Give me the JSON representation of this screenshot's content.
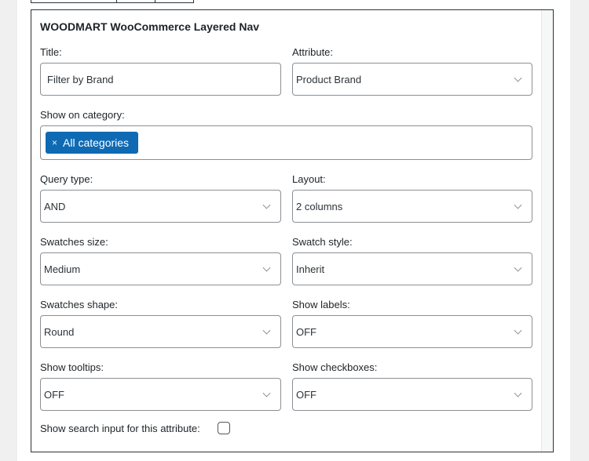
{
  "widget": {
    "title": "WOODMART WooCommerce Layered Nav"
  },
  "fields": {
    "title": {
      "label": "Title:",
      "value": "Filter by Brand"
    },
    "attribute": {
      "label": "Attribute:",
      "value": "Product Brand"
    },
    "show_on_category": {
      "label": "Show on category:",
      "chip_label": "All categories",
      "chip_remove": "×"
    },
    "query_type": {
      "label": "Query type:",
      "value": "AND"
    },
    "layout": {
      "label": "Layout:",
      "value": "2 columns"
    },
    "swatches_size": {
      "label": "Swatches size:",
      "value": "Medium"
    },
    "swatch_style": {
      "label": "Swatch style:",
      "value": "Inherit"
    },
    "swatches_shape": {
      "label": "Swatches shape:",
      "value": "Round"
    },
    "show_labels": {
      "label": "Show labels:",
      "value": "OFF"
    },
    "show_tooltips": {
      "label": "Show tooltips:",
      "value": "OFF"
    },
    "show_checkboxes": {
      "label": "Show checkboxes:",
      "value": "OFF"
    },
    "show_search_input": {
      "label": "Show search input for this attribute:",
      "checked": false
    }
  },
  "icons": {
    "select_arrow": "chevron-down-icon",
    "chip_remove": "close-icon"
  },
  "colors": {
    "chip_background": "#0f6ab4",
    "field_border": "#8c8f94",
    "page_background": "#f0f0f1"
  }
}
